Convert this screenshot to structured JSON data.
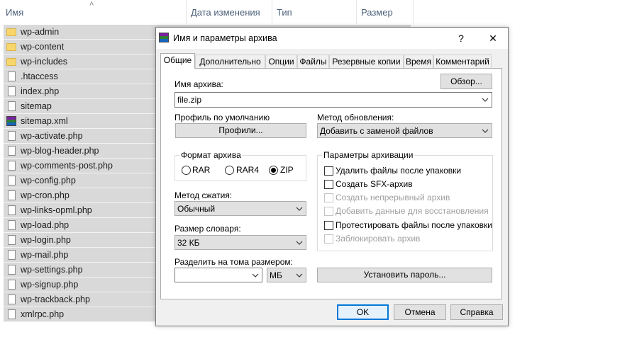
{
  "explorer": {
    "columns": {
      "name": "Имя",
      "modified": "Дата изменения",
      "type": "Тип",
      "size": "Размер"
    },
    "files": [
      {
        "name": "wp-admin",
        "icon": "folder-icon"
      },
      {
        "name": "wp-content",
        "icon": "folder-icon"
      },
      {
        "name": "wp-includes",
        "icon": "folder-icon"
      },
      {
        "name": ".htaccess",
        "icon": "file-icon"
      },
      {
        "name": "index.php",
        "icon": "file-icon"
      },
      {
        "name": "sitemap",
        "icon": "file-icon"
      },
      {
        "name": "sitemap.xml",
        "icon": "archive-icon"
      },
      {
        "name": "wp-activate.php",
        "icon": "file-icon"
      },
      {
        "name": "wp-blog-header.php",
        "icon": "file-icon"
      },
      {
        "name": "wp-comments-post.php",
        "icon": "file-icon"
      },
      {
        "name": "wp-config.php",
        "icon": "file-icon"
      },
      {
        "name": "wp-cron.php",
        "icon": "file-icon"
      },
      {
        "name": "wp-links-opml.php",
        "icon": "file-icon"
      },
      {
        "name": "wp-load.php",
        "icon": "file-icon"
      },
      {
        "name": "wp-login.php",
        "icon": "file-icon"
      },
      {
        "name": "wp-mail.php",
        "icon": "file-icon"
      },
      {
        "name": "wp-settings.php",
        "icon": "file-icon"
      },
      {
        "name": "wp-signup.php",
        "icon": "file-icon"
      },
      {
        "name": "wp-trackback.php",
        "icon": "file-icon"
      },
      {
        "name": "xmlrpc.php",
        "icon": "file-icon"
      }
    ]
  },
  "dialog": {
    "title": "Имя и параметры архива",
    "help_glyph": "?",
    "close_glyph": "✕",
    "tabs": [
      "Общие",
      "Дополнительно",
      "Опции",
      "Файлы",
      "Резервные копии",
      "Время",
      "Комментарий"
    ],
    "archive_name_label": "Имя архива:",
    "browse_button": "Обзор...",
    "archive_name_value": "file.zip",
    "default_profile_label": "Профиль по умолчанию",
    "profiles_button": "Профили...",
    "update_method_label": "Метод обновления:",
    "update_method_value": "Добавить с заменой файлов",
    "format_group_title": "Формат архива",
    "formats": [
      {
        "label": "RAR",
        "selected": false
      },
      {
        "label": "RAR4",
        "selected": false
      },
      {
        "label": "ZIP",
        "selected": true
      }
    ],
    "compression_label": "Метод сжатия:",
    "compression_value": "Обычный",
    "dictionary_label": "Размер словаря:",
    "dictionary_value": "32 КБ",
    "split_label": "Разделить на тома размером:",
    "split_value": "",
    "split_unit": "МБ",
    "archive_options_title": "Параметры архивации",
    "options": [
      {
        "label": "Удалить файлы после упаковки",
        "checked": false,
        "enabled": true
      },
      {
        "label": "Создать SFX-архив",
        "checked": false,
        "enabled": true
      },
      {
        "label": "Создать непрерывный архив",
        "checked": false,
        "enabled": false
      },
      {
        "label": "Добавить данные для восстановления",
        "checked": false,
        "enabled": false
      },
      {
        "label": "Протестировать файлы после упаковки",
        "checked": false,
        "enabled": true
      },
      {
        "label": "Заблокировать архив",
        "checked": false,
        "enabled": false
      }
    ],
    "set_password_button": "Установить пароль...",
    "ok_button": "OK",
    "cancel_button": "Отмена",
    "help_button": "Справка",
    "accent_color": "#0078d7"
  }
}
